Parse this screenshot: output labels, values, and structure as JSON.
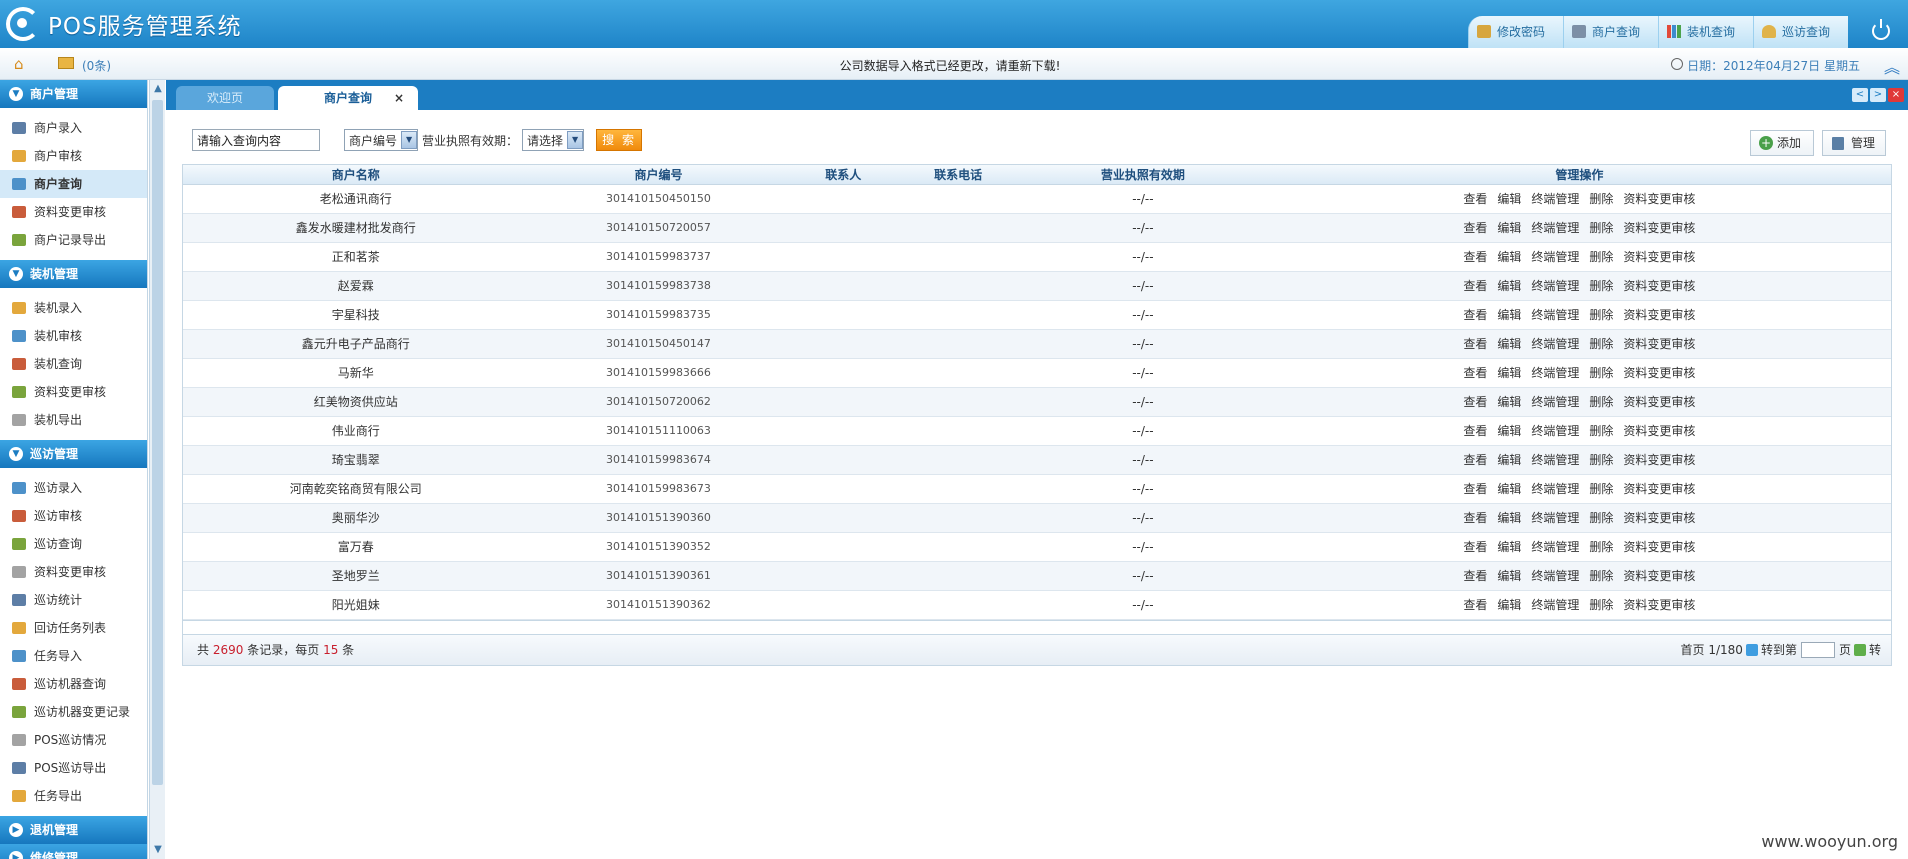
{
  "app": {
    "title": "POS服务管理系统"
  },
  "topnav": [
    {
      "label": "修改密码",
      "icon": "key-icon"
    },
    {
      "label": "商户查询",
      "icon": "list-icon"
    },
    {
      "label": "装机查询",
      "icon": "bar-chart-icon"
    },
    {
      "label": "巡访查询",
      "icon": "user-icon"
    }
  ],
  "infobar": {
    "mail_count": "(0条)",
    "notice": "公司数据导入格式已经更改，请重新下载!",
    "date": "日期：2012年04月27日 星期五"
  },
  "sidebar": {
    "groups": [
      {
        "label": "商户管理",
        "items": [
          "商户录入",
          "商户审核",
          "商户查询",
          "资料变更审核",
          "商户记录导出"
        ]
      },
      {
        "label": "装机管理",
        "items": [
          "装机录入",
          "装机审核",
          "装机查询",
          "资料变更审核",
          "装机导出"
        ]
      },
      {
        "label": "巡访管理",
        "items": [
          "巡访录入",
          "巡访审核",
          "巡访查询",
          "资料变更审核",
          "巡访统计",
          "回访任务列表",
          "任务导入",
          "巡访机器查询",
          "巡访机器变更记录",
          "POS巡访情况",
          "POS巡访导出",
          "任务导出"
        ]
      },
      {
        "label": "退机管理",
        "items": []
      },
      {
        "label": "维修管理",
        "items": []
      }
    ],
    "active": "商户查询"
  },
  "tabs": {
    "welcome": "欢迎页",
    "current": "商户查询",
    "close": "×"
  },
  "toolbar": {
    "search_value": "请输入查询内容",
    "field_select": "商户编号",
    "license_label": "营业执照有效期：",
    "license_select": "请选择",
    "search_button": "搜 索",
    "add_button": "添加",
    "manage_button": "管理"
  },
  "table": {
    "headers": [
      "商户名称",
      "商户编号",
      "联系人",
      "联系电话",
      "营业执照有效期",
      "管理操作"
    ],
    "operations": [
      "查看",
      "编辑",
      "终端管理",
      "删除",
      "资料变更审核"
    ],
    "rows": [
      {
        "name": "老松通讯商行",
        "code": "301410150450150",
        "contact": "",
        "phone": "",
        "license": "--/--"
      },
      {
        "name": "鑫发水暖建材批发商行",
        "code": "301410150720057",
        "contact": "",
        "phone": "",
        "license": "--/--"
      },
      {
        "name": "正和茗茶",
        "code": "301410159983737",
        "contact": "",
        "phone": "",
        "license": "--/--"
      },
      {
        "name": "赵爱霖",
        "code": "301410159983738",
        "contact": "",
        "phone": "",
        "license": "--/--"
      },
      {
        "name": "宇星科技",
        "code": "301410159983735",
        "contact": "",
        "phone": "",
        "license": "--/--"
      },
      {
        "name": "鑫元升电子产品商行",
        "code": "301410150450147",
        "contact": "",
        "phone": "",
        "license": "--/--"
      },
      {
        "name": "马新华",
        "code": "301410159983666",
        "contact": "",
        "phone": "",
        "license": "--/--"
      },
      {
        "name": "红美物资供应站",
        "code": "301410150720062",
        "contact": "",
        "phone": "",
        "license": "--/--"
      },
      {
        "name": "伟业商行",
        "code": "301410151110063",
        "contact": "",
        "phone": "",
        "license": "--/--"
      },
      {
        "name": "琦宝翡翠",
        "code": "301410159983674",
        "contact": "",
        "phone": "",
        "license": "--/--"
      },
      {
        "name": "河南乾奕铭商贸有限公司",
        "code": "301410159983673",
        "contact": "",
        "phone": "",
        "license": "--/--"
      },
      {
        "name": "奥丽华沙",
        "code": "301410151390360",
        "contact": "",
        "phone": "",
        "license": "--/--"
      },
      {
        "name": "富万春",
        "code": "301410151390352",
        "contact": "",
        "phone": "",
        "license": "--/--"
      },
      {
        "name": "圣地罗兰",
        "code": "301410151390361",
        "contact": "",
        "phone": "",
        "license": "--/--"
      },
      {
        "name": "阳光姐妹",
        "code": "301410151390362",
        "contact": "",
        "phone": "",
        "license": "--/--"
      }
    ]
  },
  "pager": {
    "prefix": "共",
    "total": "2690",
    "mid": "条记录，每页",
    "per_page": "15",
    "suffix": "条",
    "page_info": "首页 1/180",
    "goto_label": "转到第",
    "page_unit": "页",
    "go_label": "转"
  },
  "watermark": "www.wooyun.org"
}
